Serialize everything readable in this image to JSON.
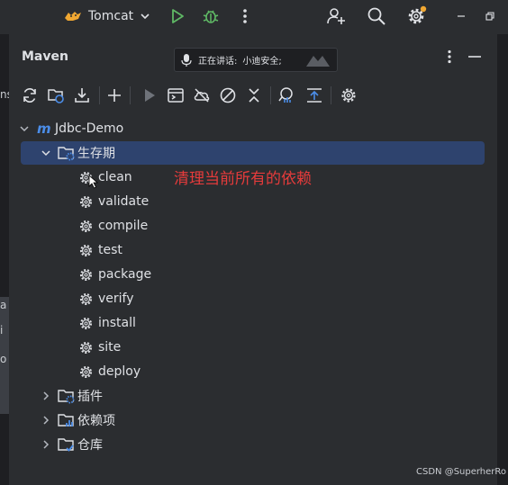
{
  "topbar": {
    "run_config_name": "Tomcat",
    "icons": [
      "tomcat-icon",
      "chevron-down-icon",
      "run-icon",
      "debug-icon",
      "more-vertical-icon",
      "add-user-icon",
      "search-icon",
      "settings-icon",
      "minimize-icon",
      "restore-icon"
    ]
  },
  "panel": {
    "title": "Maven",
    "speech": {
      "label": "正在讲话:",
      "value": "小迪安全;"
    }
  },
  "toolbar": {
    "icons": [
      "reload-icon",
      "reload-folder-icon",
      "download-icon",
      "add-icon",
      "run-icon",
      "run-config-icon",
      "offline-icon",
      "skip-tests-icon",
      "collapse-icon",
      "analyze-icon",
      "show-dependencies-icon",
      "maven-settings-icon"
    ]
  },
  "tree": {
    "project": "Jdbc-Demo",
    "lifecycle": {
      "label": "生存期",
      "phases": [
        "clean",
        "validate",
        "compile",
        "test",
        "package",
        "verify",
        "install",
        "site",
        "deploy"
      ]
    },
    "plugins": "插件",
    "dependencies": "依赖项",
    "repositories": "仓库"
  },
  "annotation": "清理当前所有的依赖",
  "watermark": "CSDN @SuperherRo",
  "left_edge_chars": [
    "ns",
    "a",
    "i",
    "o"
  ],
  "colors": {
    "background": "#2b2d30",
    "selection": "#2e436e",
    "annotation": "#e53b3b",
    "run_green": "#5fb865",
    "maven_blue": "#4b8de8",
    "badge_orange": "#f0a732"
  }
}
